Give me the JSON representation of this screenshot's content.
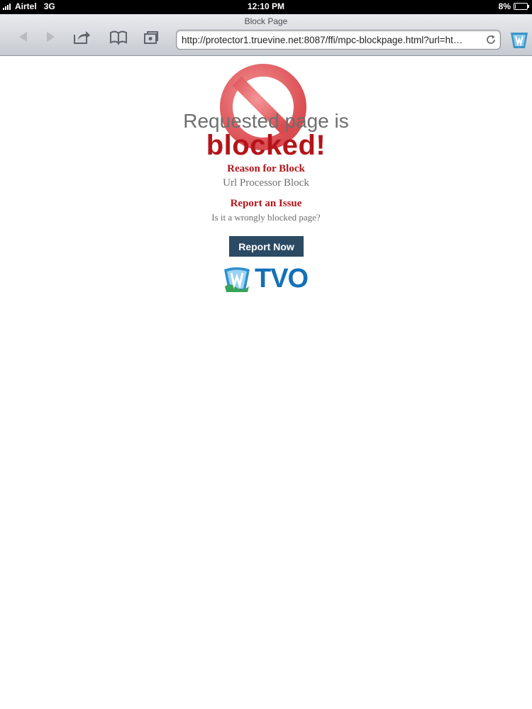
{
  "status_bar": {
    "carrier": "Airtel",
    "network": "3G",
    "time": "12:10 PM",
    "battery": "8%",
    "battery_level": 0.08
  },
  "browser": {
    "page_title": "Block Page",
    "url": "http://protector1.truevine.net:8087/ffi/mpc-blockpage.html?url=ht…",
    "icons": [
      "back-icon",
      "forward-icon",
      "share-icon",
      "bookmarks-icon",
      "tabs-icon",
      "reload-icon",
      "extension-icon"
    ]
  },
  "block_page": {
    "headline": "Requested page is",
    "status": "blocked!",
    "reason_title": "Reason for Block",
    "reason_value": "Url Processor Block",
    "report_title": "Report an Issue",
    "report_question": "Is it a wrongly blocked page?",
    "report_button": "Report Now",
    "logo_text": "TVO",
    "colors": {
      "accent_red": "#b4141a",
      "button_blue": "#2b4a63",
      "logo_blue": "#1470b8"
    }
  }
}
